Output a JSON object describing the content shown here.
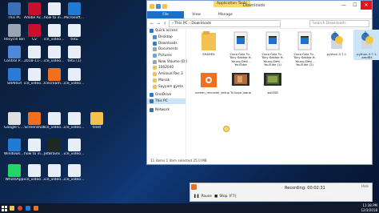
{
  "desktop": {
    "icons": [
      {
        "label": "This PC",
        "color": "#3a6fb5"
      },
      {
        "label": "Adobe Acrobat DC",
        "color": "#c8102e"
      },
      {
        "label": "how to install python",
        "color": "#e8eef7"
      },
      {
        "label": "Microsoft Edge",
        "color": "#1f7bd4"
      },
      {
        "label": "Recycle Bin",
        "color": "#9aa5b4"
      },
      {
        "label": "Cv",
        "color": "#c8102e"
      },
      {
        "label": "ice_video_2...",
        "color": "#e8eef7"
      },
      {
        "label": "tetu",
        "color": "#e8eef7"
      },
      {
        "label": "Control Panel",
        "color": "#4a8ad8"
      },
      {
        "label": "2018-11-06 (1)",
        "color": "#e8eef7"
      },
      {
        "label": "ice_video_2...",
        "color": "#e8eef7"
      },
      {
        "label": "tetu (1)",
        "color": "#e8eef7"
      },
      {
        "label": "SHAREit",
        "color": "#2a7bd6"
      },
      {
        "label": "ice_video_2...",
        "color": "#e8eef7"
      },
      {
        "label": "Icecream Screen ...",
        "color": "#f07020"
      },
      {
        "label": "ice_video_2...",
        "color": "#e8eef7"
      },
      {
        "label": "Google Chrome",
        "color": "#e0e0e0"
      },
      {
        "label": "Screenshot",
        "color": "#f07020"
      },
      {
        "label": "ice_video_2...",
        "color": "#e8eef7"
      },
      {
        "label": "ice_video_2...",
        "color": "#e8eef7"
      },
      {
        "label": "trest",
        "color": "#f2c14e"
      },
      {
        "label": "Windows 10 Update As...",
        "color": "#1f7bd4"
      },
      {
        "label": "how to install python 3.7...",
        "color": "#e8eef7"
      },
      {
        "label": "JetBrains PyCharm ...",
        "color": "#1e2a20"
      },
      {
        "label": "ice_video_2...",
        "color": "#e8eef7"
      },
      {
        "label": "WhatsApp",
        "color": "#25d366"
      },
      {
        "label": "ice_video_2...",
        "color": "#e8eef7"
      },
      {
        "label": "ice_video_2...",
        "color": "#e8eef7"
      },
      {
        "label": "ice_video_2...",
        "color": "#e8eef7"
      }
    ]
  },
  "explorer": {
    "app_tools": "Application Tools",
    "manage": "Manage",
    "window_title": "Downloads",
    "tabs": [
      "File",
      "Home",
      "Share",
      "View"
    ],
    "address": "› This PC › Downloads",
    "search_placeholder": "Search Downloads",
    "nav": [
      {
        "label": "Quick access",
        "color": "#1f7bd4",
        "selected": false
      },
      {
        "label": "Desktop",
        "color": "#4a8ad8",
        "selected": false
      },
      {
        "label": "Downloads",
        "color": "#2f7fd8",
        "selected": false
      },
      {
        "label": "Documents",
        "color": "#9aa5b4",
        "selected": false
      },
      {
        "label": "Pictures",
        "color": "#6aa7e0",
        "selected": false
      },
      {
        "label": "New Volume (D:)",
        "color": "#9aa5b4",
        "selected": false
      },
      {
        "label": "1002040",
        "color": "#f2c14e",
        "selected": false
      },
      {
        "label": "Amiloud Res 3",
        "color": "#f2c14e",
        "selected": false
      },
      {
        "label": "Manak",
        "color": "#f2c14e",
        "selected": false
      },
      {
        "label": "Sayyam gyeta",
        "color": "#f2c14e",
        "selected": false
      },
      {
        "label": "OneDrive",
        "color": "#1f7bd4",
        "selected": false
      },
      {
        "label": "This PC",
        "color": "#3a6fb5",
        "selected": true
      },
      {
        "label": "Network",
        "color": "#3a6fb5",
        "selected": false
      }
    ],
    "files": [
      {
        "name": "SHAREit",
        "kind": "folder"
      },
      {
        "name": "Coca Cola Tu - Tony Kakkar ft. Young Desi - YouTube",
        "kind": "video"
      },
      {
        "name": "Coca Cola Tu - Tony Kakkar ft. Young Desi - YouTube (1)",
        "kind": "video"
      },
      {
        "name": "Coca Cola Tu - Tony Kakkar ft. Young Desi - YouTube (2)",
        "kind": "video"
      },
      {
        "name": "python-3.7.1",
        "kind": "python"
      },
      {
        "name": "python-3.7.1-amd64",
        "kind": "python-sel"
      },
      {
        "name": "screen_recorder_setup",
        "kind": "recorder"
      },
      {
        "name": "Tu kaya Jaane",
        "kind": "film"
      },
      {
        "name": "wsi508",
        "kind": "film2"
      }
    ],
    "status": "11 items    1 item selected  25.0 MB"
  },
  "recorder": {
    "recording_label": "Recording:",
    "time": "00:02:31",
    "pause": "Pause",
    "stop": "Stop",
    "stop_key": "(F7)",
    "hide": "Hide"
  },
  "taskbar": {
    "time": "11:38 PM",
    "date": "12/3/2018"
  },
  "watermark": "Apecsn"
}
